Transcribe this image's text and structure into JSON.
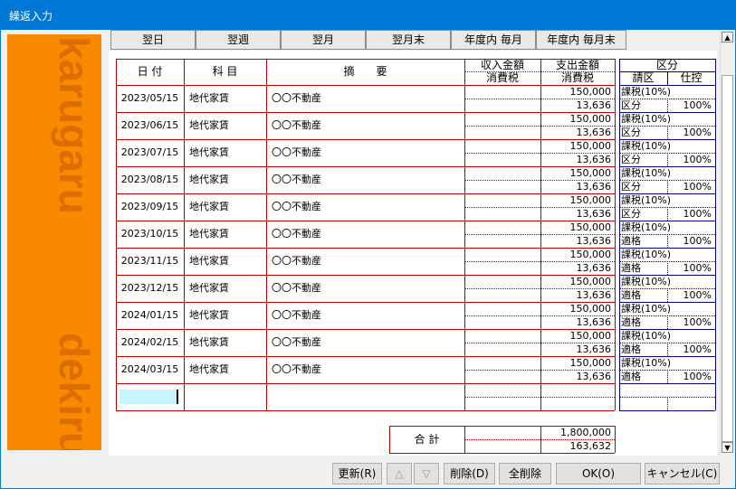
{
  "window": {
    "title": "繰返入力"
  },
  "sidebar": {
    "word1": "karugaru",
    "word2": "dekiru"
  },
  "quick_buttons": [
    "翌日",
    "翌週",
    "翌月",
    "翌月末",
    "年度内 毎月",
    "年度内 毎月末"
  ],
  "headers": {
    "date": "日 付",
    "account": "科 目",
    "summary": "摘　　要",
    "income": "収入金額",
    "income_tax": "消費税",
    "expense": "支出金額",
    "expense_tax": "消費税",
    "category": "区分",
    "req": "請区",
    "deduct": "仕控"
  },
  "rows": [
    {
      "date": "2023/05/15",
      "account": "地代家賃",
      "summary": "〇〇不動産",
      "expense": "150,000",
      "tax": "13,636",
      "cat": "課税(10%)",
      "req": "区分",
      "deduct": "100%"
    },
    {
      "date": "2023/06/15",
      "account": "地代家賃",
      "summary": "〇〇不動産",
      "expense": "150,000",
      "tax": "13,636",
      "cat": "課税(10%)",
      "req": "区分",
      "deduct": "100%"
    },
    {
      "date": "2023/07/15",
      "account": "地代家賃",
      "summary": "〇〇不動産",
      "expense": "150,000",
      "tax": "13,636",
      "cat": "課税(10%)",
      "req": "区分",
      "deduct": "100%"
    },
    {
      "date": "2023/08/15",
      "account": "地代家賃",
      "summary": "〇〇不動産",
      "expense": "150,000",
      "tax": "13,636",
      "cat": "課税(10%)",
      "req": "区分",
      "deduct": "100%"
    },
    {
      "date": "2023/09/15",
      "account": "地代家賃",
      "summary": "〇〇不動産",
      "expense": "150,000",
      "tax": "13,636",
      "cat": "課税(10%)",
      "req": "区分",
      "deduct": "100%"
    },
    {
      "date": "2023/10/15",
      "account": "地代家賃",
      "summary": "〇〇不動産",
      "expense": "150,000",
      "tax": "13,636",
      "cat": "課税(10%)",
      "req": "適格",
      "deduct": "100%"
    },
    {
      "date": "2023/11/15",
      "account": "地代家賃",
      "summary": "〇〇不動産",
      "expense": "150,000",
      "tax": "13,636",
      "cat": "課税(10%)",
      "req": "適格",
      "deduct": "100%"
    },
    {
      "date": "2023/12/15",
      "account": "地代家賃",
      "summary": "〇〇不動産",
      "expense": "150,000",
      "tax": "13,636",
      "cat": "課税(10%)",
      "req": "適格",
      "deduct": "100%"
    },
    {
      "date": "2024/01/15",
      "account": "地代家賃",
      "summary": "〇〇不動産",
      "expense": "150,000",
      "tax": "13,636",
      "cat": "課税(10%)",
      "req": "適格",
      "deduct": "100%"
    },
    {
      "date": "2024/02/15",
      "account": "地代家賃",
      "summary": "〇〇不動産",
      "expense": "150,000",
      "tax": "13,636",
      "cat": "課税(10%)",
      "req": "適格",
      "deduct": "100%"
    },
    {
      "date": "2024/03/15",
      "account": "地代家賃",
      "summary": "〇〇不動産",
      "expense": "150,000",
      "tax": "13,636",
      "cat": "課税(10%)",
      "req": "適格",
      "deduct": "100%"
    }
  ],
  "totals": {
    "label": "合 計",
    "expense": "1,800,000",
    "tax": "163,632"
  },
  "footer": {
    "update": "更新(R)",
    "up": "△",
    "down": "▽",
    "delete": "削除(D)",
    "delete_all": "全削除",
    "ok": "OK(O)",
    "cancel": "キャンセル(C)"
  },
  "scrollbar": {
    "up": "▲",
    "down": "▼"
  },
  "colors": {
    "title_bar": "#0078d7",
    "grid_red": "#c00000",
    "grid_navy": "#000080",
    "sidebar_orange": "#f98a00",
    "input_highlight": "#c8f4ff"
  }
}
